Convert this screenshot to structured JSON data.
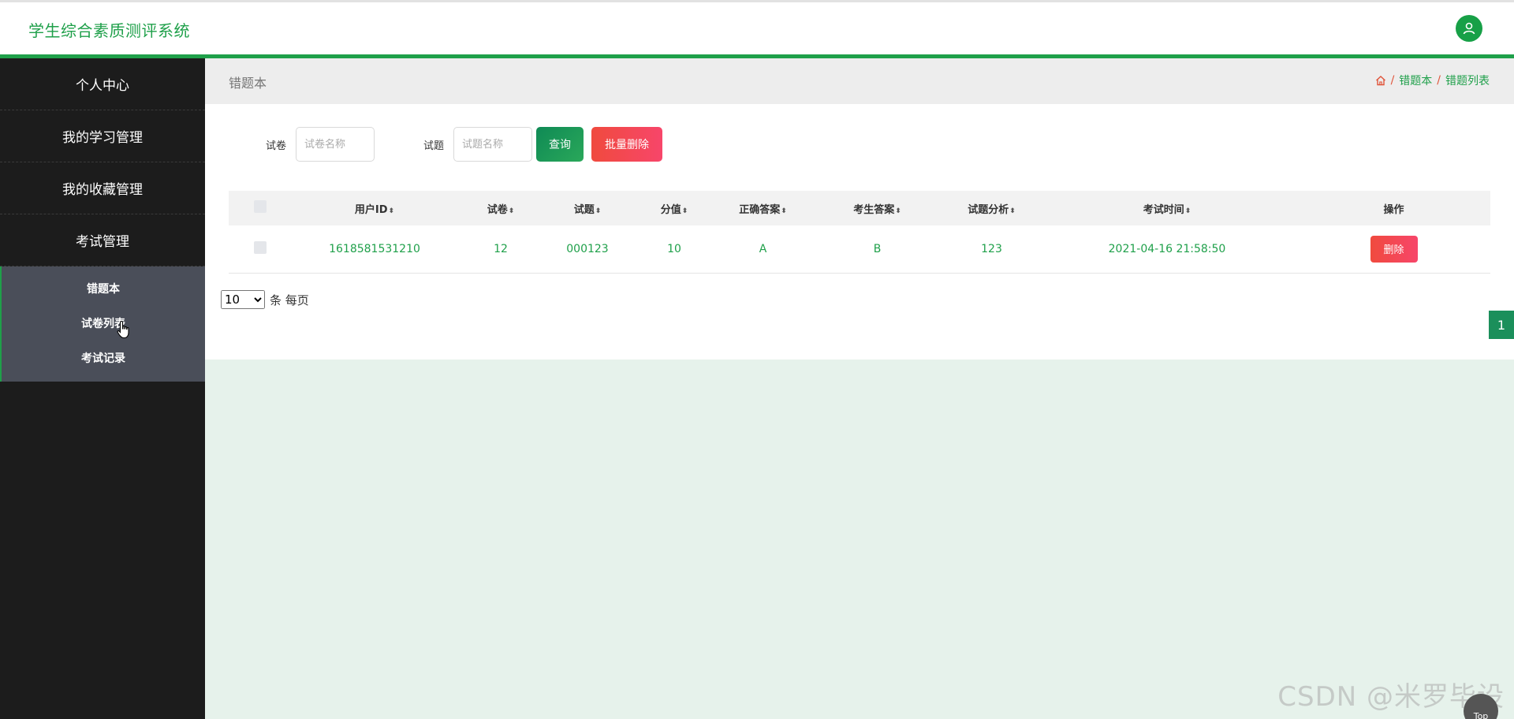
{
  "header": {
    "title": "学生综合素质测评系统",
    "avatar_icon": "user-icon"
  },
  "sidebar": {
    "items": [
      {
        "label": "个人中心"
      },
      {
        "label": "我的学习管理"
      },
      {
        "label": "我的收藏管理"
      },
      {
        "label": "考试管理"
      }
    ],
    "submenu": [
      {
        "label": "错题本"
      },
      {
        "label": "试卷列表"
      },
      {
        "label": "考试记录"
      }
    ]
  },
  "crumbbar": {
    "title": "错题本",
    "home_icon": "home-icon",
    "crumbs": [
      "错题本",
      "错题列表"
    ],
    "separator": "/"
  },
  "search": {
    "paper_label": "试卷",
    "paper_placeholder": "试卷名称",
    "question_label": "试题",
    "question_placeholder": "试题名称",
    "search_button": "查询",
    "batch_delete_button": "批量删除"
  },
  "table": {
    "columns": [
      "用户ID",
      "试卷",
      "试题",
      "分值",
      "正确答案",
      "考生答案",
      "试题分析",
      "考试时间",
      "操作"
    ],
    "sort_glyph": "⬍",
    "rows": [
      {
        "user_id": "1618581531210",
        "paper": "12",
        "question": "000123",
        "score": "10",
        "correct_answer": "A",
        "student_answer": "B",
        "analysis": "123",
        "exam_time": "2021-04-16 21:58:50",
        "action": "删除"
      }
    ]
  },
  "pagination": {
    "page_size": "10",
    "page_size_options": [
      "10"
    ],
    "per_page_label": "条 每页",
    "current_page": "1"
  },
  "watermark": "CSDN @米罗毕设",
  "back_to_top": "Top",
  "colors": {
    "brand": "#1fa04a",
    "danger": "#f04a3e",
    "sidebar_bg": "#1c1c1c"
  }
}
